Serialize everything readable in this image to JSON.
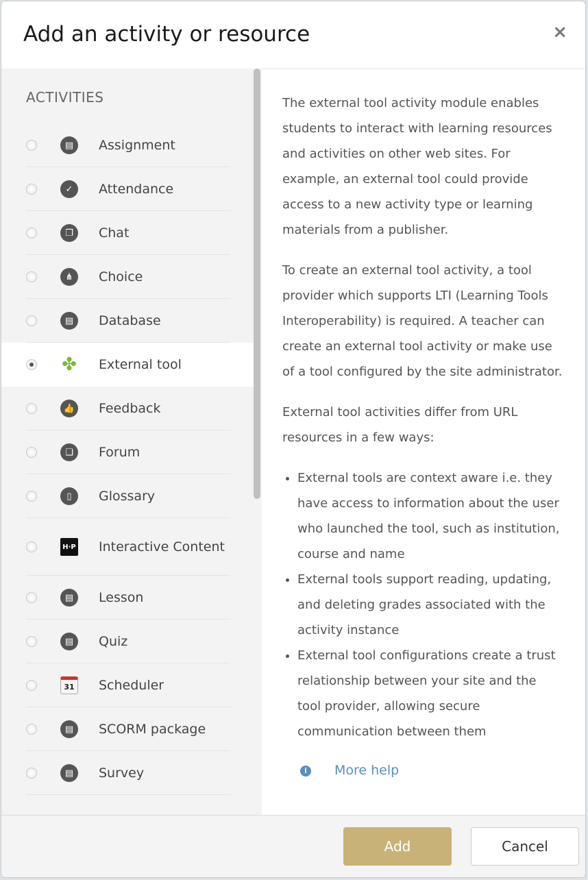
{
  "dialog": {
    "title": "Add an activity or resource",
    "close_glyph": "×"
  },
  "sidebar": {
    "section_label": "ACTIVITIES",
    "items": [
      {
        "label": "Assignment",
        "icon": "assignment-icon",
        "glyph": "▤"
      },
      {
        "label": "Attendance",
        "icon": "attendance-icon",
        "glyph": "✓"
      },
      {
        "label": "Chat",
        "icon": "chat-icon",
        "glyph": "❐"
      },
      {
        "label": "Choice",
        "icon": "choice-icon",
        "glyph": "⋔"
      },
      {
        "label": "Database",
        "icon": "database-icon",
        "glyph": "▤"
      },
      {
        "label": "External tool",
        "icon": "puzzle-icon",
        "glyph": "✤",
        "selected": true
      },
      {
        "label": "Feedback",
        "icon": "feedback-icon",
        "glyph": "👍"
      },
      {
        "label": "Forum",
        "icon": "forum-icon",
        "glyph": "❏"
      },
      {
        "label": "Glossary",
        "icon": "glossary-icon",
        "glyph": "▯"
      },
      {
        "label": "Interactive Content",
        "icon": "h5p-icon",
        "glyph": "H·P"
      },
      {
        "label": "Lesson",
        "icon": "lesson-icon",
        "glyph": "▤"
      },
      {
        "label": "Quiz",
        "icon": "quiz-icon",
        "glyph": "▤"
      },
      {
        "label": "Scheduler",
        "icon": "calendar-icon",
        "glyph": "31"
      },
      {
        "label": "SCORM package",
        "icon": "scorm-icon",
        "glyph": "▤"
      },
      {
        "label": "Survey",
        "icon": "survey-icon",
        "glyph": "▤"
      }
    ]
  },
  "description": {
    "para1": "The external tool activity module enables students to interact with learning resources and activities on other web sites. For example, an external tool could provide access to a new activity type or learning materials from a publisher.",
    "para2": "To create an external tool activity, a tool provider which supports LTI (Learning Tools Interoperability) is required. A teacher can create an external tool activity or make use of a tool configured by the site administrator.",
    "para3": "External tool activities differ from URL resources in a few ways:",
    "bullets": [
      "External tools are context aware i.e. they have access to information about the user who launched the tool, such as institution, course and name",
      "External tools support reading, updating, and deleting grades associated with the activity instance",
      "External tool configurations create a trust relationship between your site and the tool provider, allowing secure communication between them"
    ],
    "more_help": "More help",
    "info_glyph": "i"
  },
  "footer": {
    "add_label": "Add",
    "cancel_label": "Cancel"
  },
  "colors": {
    "accent": "#c8b277",
    "link": "#5a8fbf",
    "puzzle": "#7ab934"
  }
}
